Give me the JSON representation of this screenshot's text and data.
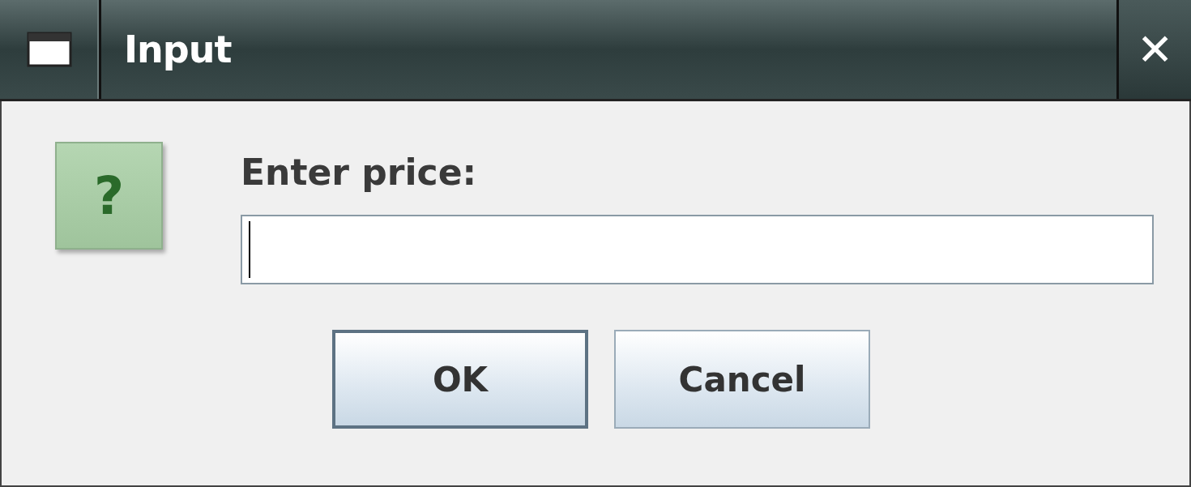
{
  "window": {
    "title": "Input",
    "close_symbol": "✕"
  },
  "dialog": {
    "icon_symbol": "?",
    "prompt": "Enter price:",
    "input": {
      "focused": true
    },
    "buttons": [
      {
        "label": "OK",
        "focused": true
      },
      {
        "label": "Cancel",
        "focused": false
      }
    ]
  }
}
